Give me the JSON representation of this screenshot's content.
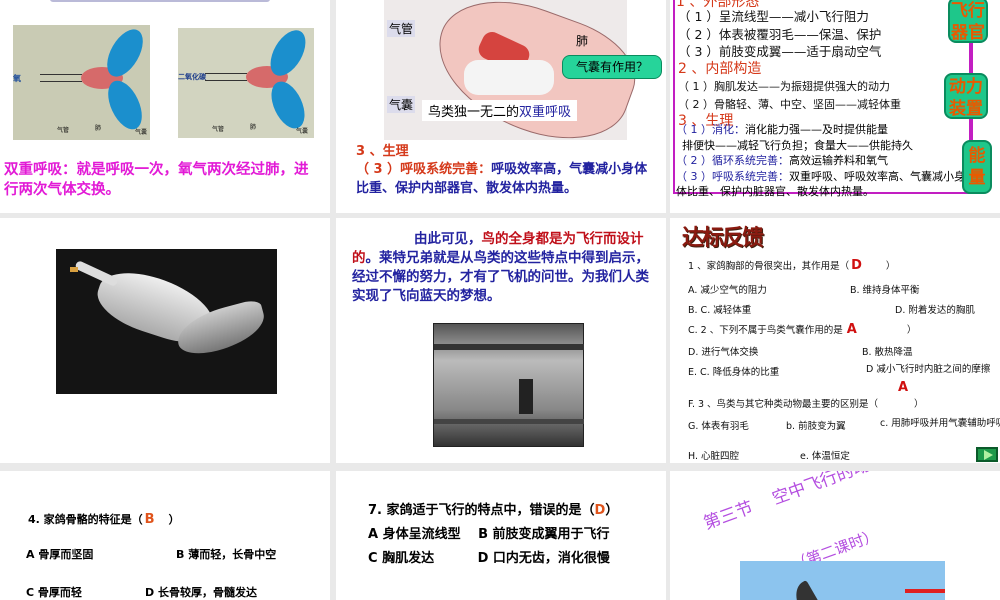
{
  "slides": [
    {
      "id": 1,
      "diagram_labels": {
        "left_gas": "氧",
        "right_gas": "二氧化碳",
        "trachea": "气管",
        "lung": "肺",
        "air_sac": "气囊"
      },
      "text": "双重呼吸：就是呼吸一次，氧气两次经过肺，进行两次气体交换。"
    },
    {
      "id": 2,
      "labels": {
        "trachea": "气管",
        "lung": "肺",
        "air_sac": "气囊"
      },
      "bubble": "气囊有作用？",
      "caption_black": "鸟类独一无二的",
      "caption_blue": "双重呼吸",
      "heading": "3 、生理",
      "point_label": "（ 3 ）呼吸系统完善：",
      "point_text": "呼吸效率高，气囊减小身体比重、保护内部器官、散发体内热量。"
    },
    {
      "id": 3,
      "lines": [
        {
          "t": "（ 1 ）呈流线型——减小飞行阻力",
          "c": "blk"
        },
        {
          "t": "（ 2 ）体表被覆羽毛——保温、保护",
          "c": "blk"
        },
        {
          "t": "（ 3 ）前肢变成翼——适于扇动空气",
          "c": "blk"
        },
        {
          "t": "2 、内部构造",
          "c": "red"
        },
        {
          "t": "（ 1 ）胸肌发达——为振翅提供强大的动力",
          "c": "blk"
        },
        {
          "t": "（ 2 ）骨骼轻、薄、中空、坚固——减轻体重",
          "c": "blk"
        },
        {
          "t": "3 、生理",
          "c": "red"
        }
      ],
      "physiology": [
        {
          "label": "（ 1 ）消化：",
          "text": "消化能力强——及时提供能量"
        },
        {
          "label": "",
          "text": "排便快——减轻飞行负担；食量大——供能持久"
        },
        {
          "label": "（ 2 ）循环系统完善：",
          "text": "高效运输养料和氧气"
        },
        {
          "label": "（ 3 ）呼吸系统完善：",
          "text": "双重呼吸、呼吸效率高、气囊减小身体比重、保护内脏器官、散发体内热量。"
        }
      ],
      "callouts": [
        "飞行器官",
        "动力装置",
        "能量"
      ]
    },
    {
      "id": 4
    },
    {
      "id": 5,
      "text_blue1": "由此可见，",
      "text_red": "鸟的全身都是为飞行而设计的",
      "text_blue2": "。莱特兄弟就是从鸟类的这些特点中得到启示，经过不懈的努力，才有了飞机的问世。为我们人类实现了飞向蓝天的梦想。"
    },
    {
      "id": 6,
      "title": "达标反馈",
      "items": [
        {
          "t": "1 、家鸽胸部的骨很突出，其作用是（",
          "a": "D",
          "e": "）"
        },
        {
          "t": "A. 减少空气的阻力",
          "r": "B. 维持身体平衡"
        },
        {
          "t": "B. C. 减轻体重",
          "r": "D. 附着发达的胸肌"
        },
        {
          "t": "C. 2 、下列不属于鸟类气囊作用的是",
          "a": "A",
          "e": "）"
        },
        {
          "t": "D. 进行气体交换",
          "r": "B. 散热降温"
        },
        {
          "t": "E. C. 降低身体的比重",
          "r": "D  减小飞行时内脏之间的摩擦"
        },
        {
          "t": "F. 3 、鸟类与其它种类动物最主要的区别是（",
          "a": "A",
          "e": "）"
        },
        {
          "t": "G. 体表有羽毛",
          "m": "b. 前肢变为翼",
          "r": "c. 用肺呼吸并用气囊辅助呼吸"
        },
        {
          "t": "H. 心脏四腔",
          "m": "e. 体温恒定"
        }
      ]
    },
    {
      "id": 7,
      "q": "4. 家鸽骨骼的特征是（",
      "a": "B",
      "e": "）",
      "opts": [
        "A 骨厚而坚固",
        "B 薄而轻，长骨中空",
        "C 骨厚而轻",
        "D 长骨较厚，骨髓发达"
      ]
    },
    {
      "id": 8,
      "q": "7. 家鸽适于飞行的特点中，错误的是（",
      "a": "D",
      "e": "）",
      "opts": "A 身体呈流线型　 B 前肢变成翼用于飞行　 C 胸肌发达　　　 D 口内无齿，消化很慢"
    },
    {
      "id": 9,
      "title1": "第三节",
      "title2": "空中飞行的动物",
      "title3": "（第二课时）"
    }
  ]
}
